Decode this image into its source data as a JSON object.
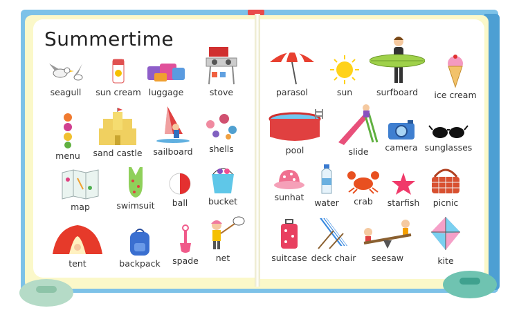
{
  "title": "Summertime",
  "items": [
    {
      "label": "seagull",
      "icon": "seagull-icon"
    },
    {
      "label": "sun cream",
      "icon": "sun-cream-icon"
    },
    {
      "label": "luggage",
      "icon": "luggage-icon"
    },
    {
      "label": "stove",
      "icon": "stove-icon"
    },
    {
      "label": "parasol",
      "icon": "parasol-icon"
    },
    {
      "label": "sun",
      "icon": "sun-icon"
    },
    {
      "label": "surfboard",
      "icon": "surfboard-icon"
    },
    {
      "label": "ice cream",
      "icon": "ice-cream-icon"
    },
    {
      "label": "menu",
      "icon": "menu-icon"
    },
    {
      "label": "sand castle",
      "icon": "sand-castle-icon"
    },
    {
      "label": "sailboard",
      "icon": "sailboard-icon"
    },
    {
      "label": "shells",
      "icon": "shells-icon"
    },
    {
      "label": "pool",
      "icon": "pool-icon"
    },
    {
      "label": "slide",
      "icon": "slide-icon"
    },
    {
      "label": "camera",
      "icon": "camera-icon"
    },
    {
      "label": "sunglasses",
      "icon": "sunglasses-icon"
    },
    {
      "label": "map",
      "icon": "map-icon"
    },
    {
      "label": "swimsuit",
      "icon": "swimsuit-icon"
    },
    {
      "label": "ball",
      "icon": "ball-icon"
    },
    {
      "label": "bucket",
      "icon": "bucket-icon"
    },
    {
      "label": "sunhat",
      "icon": "sunhat-icon"
    },
    {
      "label": "water",
      "icon": "water-bottle-icon"
    },
    {
      "label": "crab",
      "icon": "crab-icon"
    },
    {
      "label": "starfish",
      "icon": "starfish-icon"
    },
    {
      "label": "picnic",
      "icon": "picnic-basket-icon"
    },
    {
      "label": "tent",
      "icon": "tent-icon"
    },
    {
      "label": "backpack",
      "icon": "backpack-icon"
    },
    {
      "label": "spade",
      "icon": "spade-icon"
    },
    {
      "label": "net",
      "icon": "net-icon"
    },
    {
      "label": "suitcase",
      "icon": "suitcase-icon"
    },
    {
      "label": "deck chair",
      "icon": "deck-chair-icon"
    },
    {
      "label": "seesaw",
      "icon": "seesaw-icon"
    },
    {
      "label": "kite",
      "icon": "kite-icon"
    }
  ],
  "colors": {
    "board": "#7dc2e8",
    "page_border": "#fbf8c9",
    "page": "#ffffff",
    "ribbon": "#e94b4b"
  }
}
